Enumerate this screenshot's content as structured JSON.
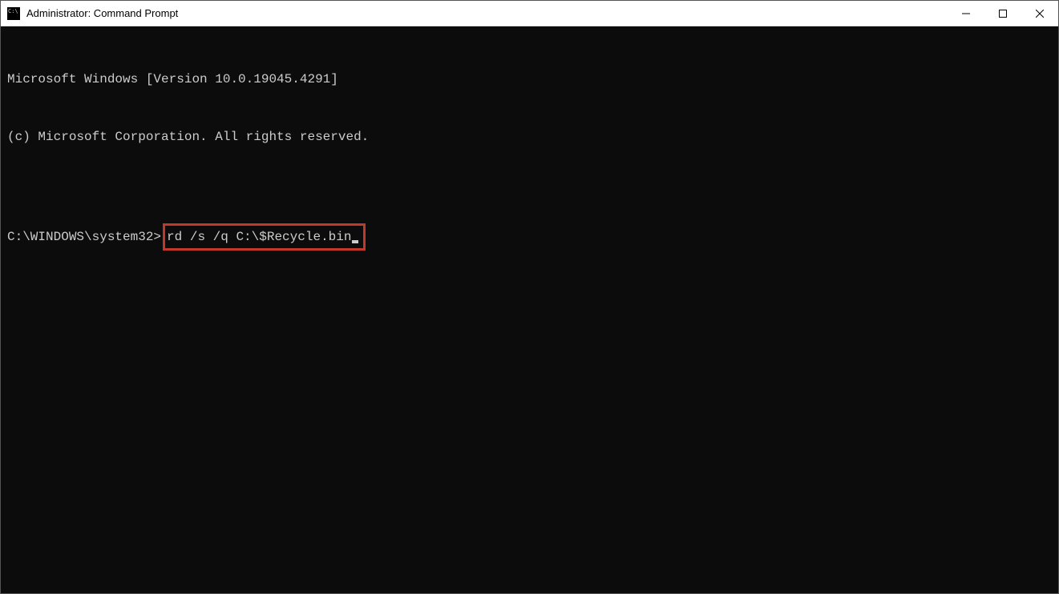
{
  "titlebar": {
    "title": "Administrator: Command Prompt"
  },
  "terminal": {
    "line1": "Microsoft Windows [Version 10.0.19045.4291]",
    "line2": "(c) Microsoft Corporation. All rights reserved.",
    "blank": "",
    "prompt": "C:\\WINDOWS\\system32>",
    "command": "rd /s /q C:\\$Recycle.bin"
  },
  "highlight": {
    "color": "#c0392b"
  }
}
